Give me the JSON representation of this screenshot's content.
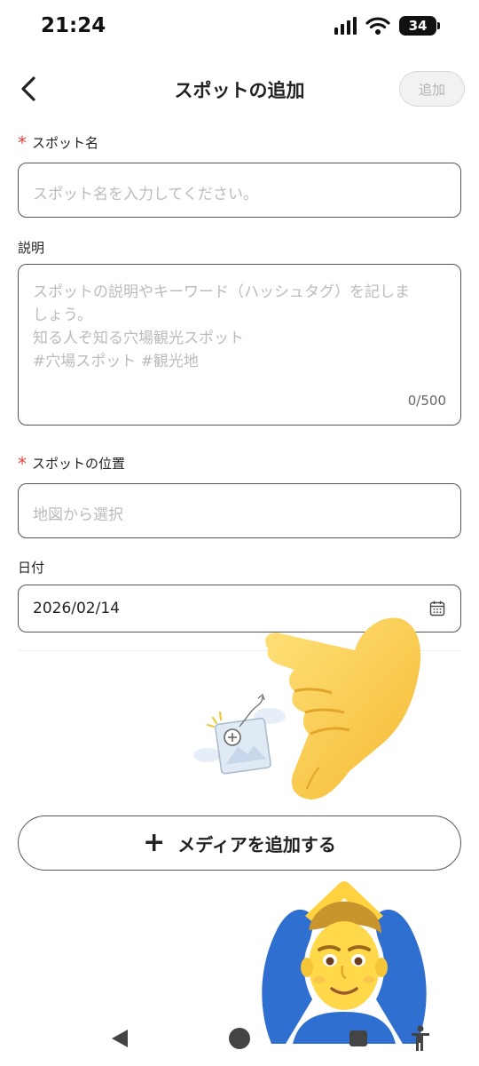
{
  "status_bar": {
    "time": "21:24",
    "battery": "34"
  },
  "header": {
    "title": "スポットの追加",
    "add_label": "追加"
  },
  "form": {
    "spot_name": {
      "label": "スポット名",
      "placeholder": "スポット名を入力してください。"
    },
    "description": {
      "label": "説明",
      "placeholder_lines": [
        "スポットの説明やキーワード（ハッシュタグ）を記しま",
        "しょう。",
        "知る人ぞ知る穴場観光スポット",
        "#穴場スポット #観光地"
      ],
      "counter": "0/500"
    },
    "location": {
      "label": "スポットの位置",
      "placeholder": "地図から選択"
    },
    "date": {
      "label": "日付",
      "value": "2026/02/14"
    }
  },
  "media": {
    "button_label": "メディアを追加する"
  },
  "colors": {
    "required": "#e0463b",
    "placeholder": "#bbbbbb",
    "border": "#555555"
  },
  "icons": [
    "back-chevron-icon",
    "calendar-icon",
    "image-add-icon",
    "plus-icon",
    "pointing-hand-emoji",
    "memoji-sticker"
  ]
}
